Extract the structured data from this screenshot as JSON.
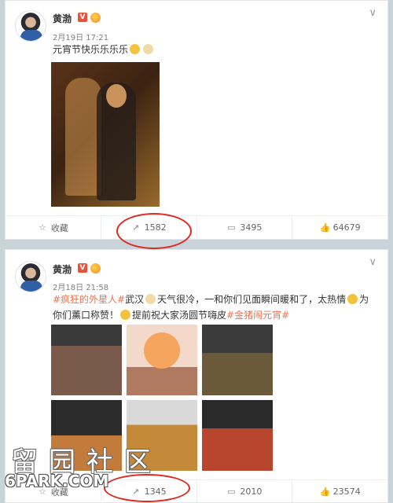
{
  "posts": [
    {
      "user": "黄渤",
      "verified_badge": "V",
      "time": "2月19日 17:21",
      "text": "元宵节快乐乐乐乐",
      "actions": {
        "favorite_label": "收藏",
        "repost_count": "1582",
        "comment_count": "3495",
        "like_count": "64679"
      }
    },
    {
      "user": "黄渤",
      "verified_badge": "V",
      "time": "2月18日 21:58",
      "text_parts": {
        "topic1": "#疯狂的外星人#",
        "seg1": "武汉",
        "seg2": "天气很冷，一和你们见面瞬间暖和了，太热情",
        "seg3": "为你们薰口称赞！",
        "seg4": "提前祝大家汤圆节嗨皮",
        "topic2": "#金猪闹元宵#"
      },
      "actions": {
        "favorite_label": "收藏",
        "repost_count": "1345",
        "comment_count": "2010",
        "like_count": "23574"
      }
    }
  ],
  "icons": [
    "star-icon",
    "repost-icon",
    "comment-icon",
    "like-icon",
    "chevron-down-icon"
  ],
  "colors": {
    "topic": "#eb7350",
    "annotation_circle": "#e0281e",
    "verified": "#e8523a"
  },
  "watermark": {
    "cn": "留园社区",
    "en": "6PARK.COM"
  }
}
